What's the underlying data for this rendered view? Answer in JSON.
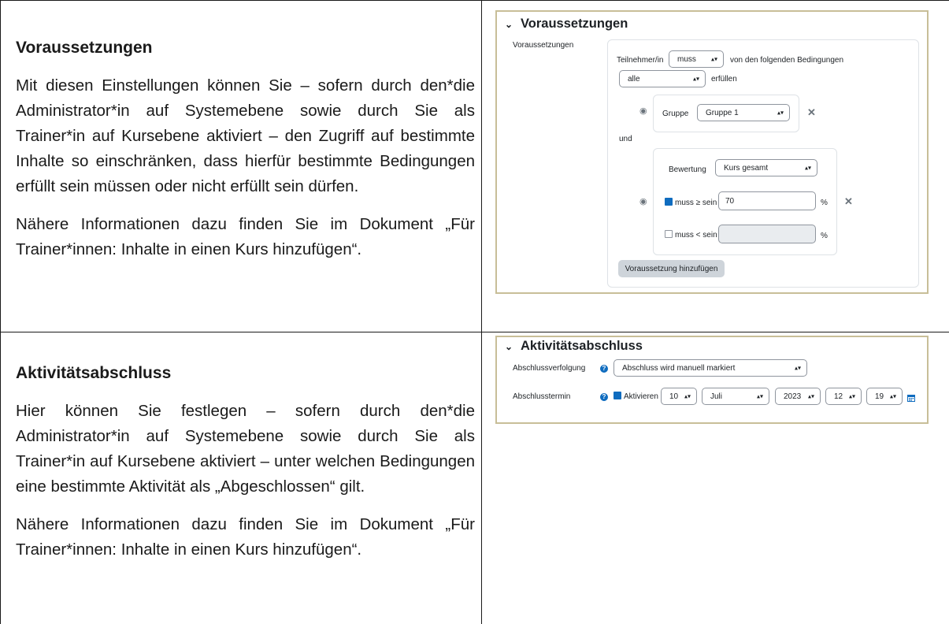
{
  "left": {
    "section1": {
      "heading": "Voraussetzungen",
      "para1": "Mit diesen Einstellungen können Sie – sofern durch den*die Administrator*in auf Systemebene sowie durch Sie als Trainer*in auf Kursebene aktiviert – den Zugriff auf bestimmte Inhalte so einschränken, dass hierfür bestimmte Bedingungen erfüllt sein müssen oder nicht erfüllt sein dürfen.",
      "para2": "Nähere Informationen dazu finden Sie im Dokument „Für Trainer*innen: Inhalte in einen Kurs hinzufügen“."
    },
    "section2": {
      "heading": "Aktivitätsabschluss",
      "para1": "Hier können Sie festlegen – sofern durch den*die Administrator*in auf Systemebene sowie durch Sie als Trainer*in auf Kursebene aktiviert – unter welchen Bedingungen eine bestimmte Aktivität als „Abgeschlossen“ gilt.",
      "para2": "Nähere Informationen dazu finden Sie im Dokument „Für Trainer*innen: Inhalte in einen Kurs hinzufügen“."
    }
  },
  "restrict": {
    "title": "Voraussetzungen",
    "field_label": "Voraussetzungen",
    "participant_label": "Teilnehmer/in",
    "must_select": "muss",
    "conditions_text": "von den folgenden Bedingungen",
    "all_select": "alle",
    "fulfil_text": "erfüllen",
    "group_label": "Gruppe",
    "group_select": "Gruppe 1",
    "and_text": "und",
    "grade_label": "Bewertung",
    "grade_select": "Kurs gesamt",
    "min_label": "muss ≥ sein",
    "min_value": "70",
    "min_checked": true,
    "max_label": "muss < sein",
    "max_value": "",
    "max_checked": false,
    "percent": "%",
    "add_button": "Voraussetzung hinzufügen"
  },
  "completion": {
    "title": "Aktivitätsabschluss",
    "tracking_label": "Abschlussverfolgung",
    "tracking_select": "Abschluss wird manuell markiert",
    "expected_label": "Abschlusstermin",
    "enable_label": "Aktivieren",
    "enable_checked": true,
    "day": "10",
    "month": "Juli",
    "year": "2023",
    "hour": "12",
    "minute": "19"
  },
  "icons": {
    "chevron": "chevron-down-icon",
    "eye": "eye-icon",
    "close": "close-icon",
    "help": "help-icon",
    "calendar": "calendar-icon",
    "select_arrow": "sort-arrows-icon"
  },
  "colors": {
    "panel_border": "#c8be98",
    "accent": "#0f6cbf",
    "button_bg": "#ced4da"
  }
}
